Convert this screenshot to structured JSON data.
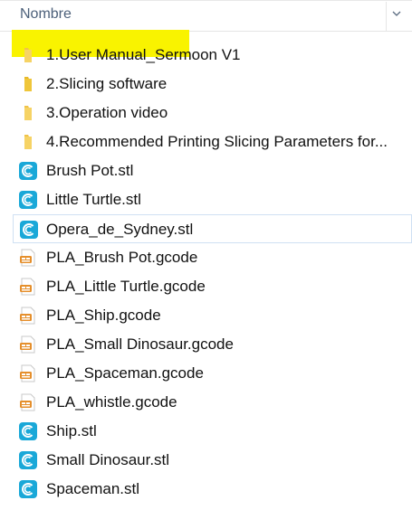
{
  "header": {
    "column_name": "Nombre"
  },
  "colors": {
    "highlight": "#f9f300",
    "folder": "#f0c348",
    "stl_icon": "#1aa8d8",
    "gcode_icon": "#e58f2c"
  },
  "files": [
    {
      "name": "1.User Manual_Sermoon V1",
      "icon": "folder-icon"
    },
    {
      "name": "2.Slicing software",
      "icon": "folder-icon"
    },
    {
      "name": "3.Operation video",
      "icon": "folder-icon"
    },
    {
      "name": "4.Recommended Printing Slicing Parameters for...",
      "icon": "folder-icon"
    },
    {
      "name": "Brush Pot.stl",
      "icon": "stl-file-icon"
    },
    {
      "name": "Little Turtle.stl",
      "icon": "stl-file-icon"
    },
    {
      "name": "Opera_de_Sydney.stl",
      "icon": "stl-file-icon"
    },
    {
      "name": "PLA_Brush Pot.gcode",
      "icon": "gcode-file-icon"
    },
    {
      "name": "PLA_Little Turtle.gcode",
      "icon": "gcode-file-icon"
    },
    {
      "name": "PLA_Ship.gcode",
      "icon": "gcode-file-icon"
    },
    {
      "name": "PLA_Small Dinosaur.gcode",
      "icon": "gcode-file-icon"
    },
    {
      "name": "PLA_Spaceman.gcode",
      "icon": "gcode-file-icon"
    },
    {
      "name": "PLA_whistle.gcode",
      "icon": "gcode-file-icon"
    },
    {
      "name": "Ship.stl",
      "icon": "stl-file-icon"
    },
    {
      "name": "Small Dinosaur.stl",
      "icon": "stl-file-icon"
    },
    {
      "name": "Spaceman.stl",
      "icon": "stl-file-icon"
    }
  ]
}
